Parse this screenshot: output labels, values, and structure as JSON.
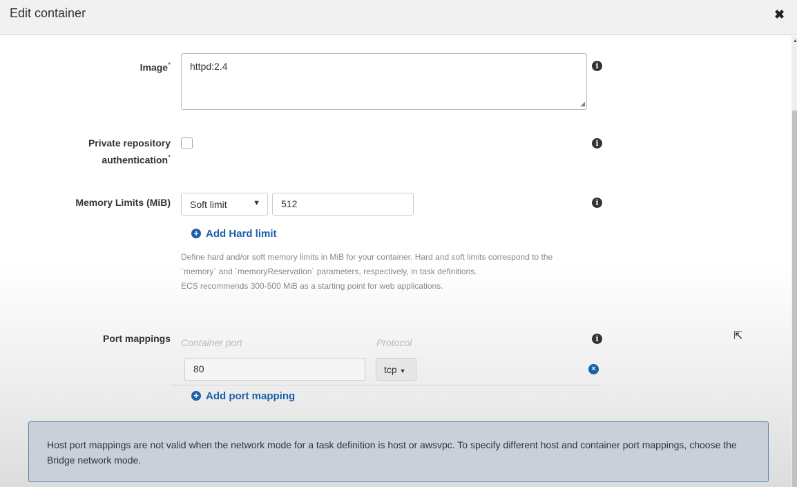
{
  "header": {
    "title": "Edit container",
    "close_icon": "close-icon"
  },
  "image": {
    "label": "Image",
    "required": "*",
    "value": "httpd:2.4"
  },
  "private_repo": {
    "label_line1": "Private repository",
    "label_line2": "authentication",
    "required": "*",
    "checked": false
  },
  "memory": {
    "label": "Memory Limits (MiB)",
    "limit_type": "Soft limit",
    "value": "512",
    "add_hard_limit": "Add Hard limit",
    "help_line1": "Define hard and/or soft memory limits in MiB for your container. Hard and soft limits correspond to the",
    "help_line2": "`memory` and `memoryReservation` parameters, respectively, in task definitions.",
    "help_line3": "ECS recommends 300-500 MiB as a starting point for web applications."
  },
  "ports": {
    "label": "Port mappings",
    "col_container": "Container port",
    "col_protocol": "Protocol",
    "rows": [
      {
        "container_port": "80",
        "protocol": "tcp"
      }
    ],
    "add_label": "Add port mapping"
  },
  "alert": {
    "text": "Host port mappings are not valid when the network mode for a task definition is host or awsvpc. To specify different host and container port mappings, choose the Bridge network mode."
  },
  "icons": {
    "info": "i",
    "plus": "+",
    "remove": "×"
  }
}
